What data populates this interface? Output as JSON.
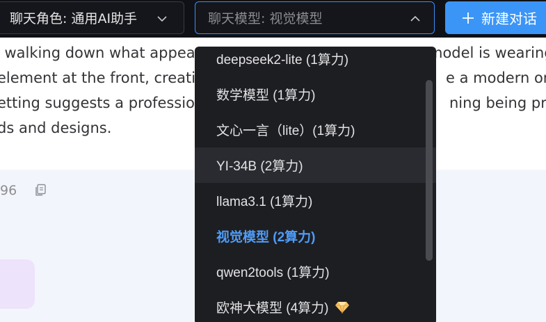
{
  "header": {
    "role_select_value": "聊天角色: 通用AI助手",
    "model_select_value": "聊天模型: 视觉模型",
    "new_chat_label": "新建对话"
  },
  "message": {
    "lines": [
      "l walking down what appea",
      "element at the front, creati",
      "etting suggests a professio",
      "ds and designs."
    ],
    "lines_right": [
      "model is wearing",
      "e a modern or c",
      "ning being pres"
    ],
    "count": "96"
  },
  "model_dropdown": {
    "items": [
      {
        "label": "deepseek2-lite (1算力)"
      },
      {
        "label": "数学模型 (1算力)"
      },
      {
        "label": "文心一言（lite）(1算力)"
      },
      {
        "label": "YI-34B (2算力)"
      },
      {
        "label": "llama3.1 (1算力)"
      },
      {
        "label": "视觉模型 (2算力)"
      },
      {
        "label": "qwen2tools (1算力)"
      },
      {
        "label": "欧神大模型 (4算力)"
      }
    ],
    "hovered_index": 3,
    "selected_index": 5
  },
  "colors": {
    "accent": "#3b95f7",
    "selected_text": "#4f9cf7",
    "topbar_bg": "#101116",
    "dropdown_bg": "#1d1e22"
  },
  "icons": {
    "role_chevron": "chevron-down-icon",
    "model_chevron": "chevron-up-icon",
    "new_chat": "plus-icon",
    "copy": "copy-icon",
    "premium": "diamond-icon"
  }
}
